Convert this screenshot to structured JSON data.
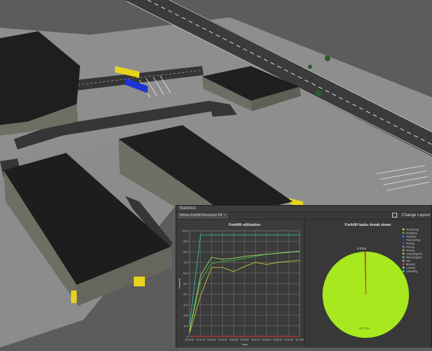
{
  "window": {
    "title": "Statistics"
  },
  "toolbar": {
    "tab_label": "Works Forklift Resource P4",
    "tab_close": "×",
    "change_layout_label": "Change Layout"
  },
  "colors": {
    "utilization": "#2fbf9f",
    "line_green": "#3fbf3f",
    "line_lightgreen": "#9fdf6f",
    "line_yellow": "#c9c23a",
    "pie_main": "#a8e81e",
    "pie_small": "#c0392b"
  },
  "chart_data": [
    {
      "type": "line",
      "title": "Forklift utilization",
      "xlabel": "Time",
      "ylabel": "Percent",
      "x": [
        "00:00:00",
        "00:01:12",
        "00:02:24",
        "00:03:36",
        "00:04:48",
        "00:06:00",
        "00:07:12",
        "00:08:24",
        "00:09:36",
        "00:10:48",
        "00:12:00"
      ],
      "y_ticks": [
        "0",
        "10.4",
        "20.8",
        "31.3",
        "41.7",
        "52.1",
        "62.5",
        "72.9",
        "83.3",
        "93.8",
        "104.2"
      ],
      "ylim": [
        0,
        104.2
      ],
      "grid": true,
      "series": [
        {
          "color_key": "utilization",
          "values": [
            10,
            100,
            100,
            100,
            100,
            100,
            100,
            100,
            100,
            100,
            100
          ]
        },
        {
          "color_key": "line_green",
          "values": [
            5,
            55,
            72,
            74,
            75,
            77,
            79,
            81,
            82,
            83,
            84
          ]
        },
        {
          "color_key": "line_lightgreen",
          "values": [
            5,
            60,
            78,
            76,
            77,
            79,
            80,
            81,
            82,
            83,
            84
          ]
        },
        {
          "color_key": "line_yellow",
          "values": [
            3,
            40,
            68,
            68,
            64,
            69,
            73,
            71,
            73,
            74,
            75
          ]
        },
        {
          "color_key": "pie_small",
          "values": [
            0,
            0,
            0,
            0,
            0,
            0,
            0,
            0,
            0,
            0,
            0
          ]
        }
      ]
    },
    {
      "type": "pie",
      "title": "Forklift tasks break down",
      "slices": [
        {
          "label": "Processing",
          "value": 99.79,
          "color": "#a8e81e",
          "data_label": "99.79%"
        },
        {
          "label": "Travelling",
          "value": 0.21,
          "color": "#c0392b",
          "data_label": "0.21%"
        }
      ],
      "legend_position": "top-right",
      "legend": [
        {
          "label": "Processing",
          "color": "#a8e81e"
        },
        {
          "label": "Repairing",
          "color": "#3fbf3f"
        },
        {
          "label": "Awaiting",
          "color": "#2f7fff"
        },
        {
          "label": "Transporting",
          "color": "#1f3fbf"
        },
        {
          "label": "Picking",
          "color": "#6f3fbf"
        },
        {
          "label": "Placing",
          "color": "#9f6fdf"
        },
        {
          "label": "Moving",
          "color": "#df9f3f"
        },
        {
          "label": "Collecting/Out",
          "color": "#bfbf3f"
        },
        {
          "label": "Returning/Out",
          "color": "#3fbfbf"
        },
        {
          "label": "Idle",
          "color": "#9f9f9f"
        },
        {
          "label": "Blocked",
          "color": "#df3f3f"
        },
        {
          "label": "Loading",
          "color": "#6fdf6f"
        },
        {
          "label": "Unloading",
          "color": "#3fdf9f"
        }
      ]
    }
  ]
}
